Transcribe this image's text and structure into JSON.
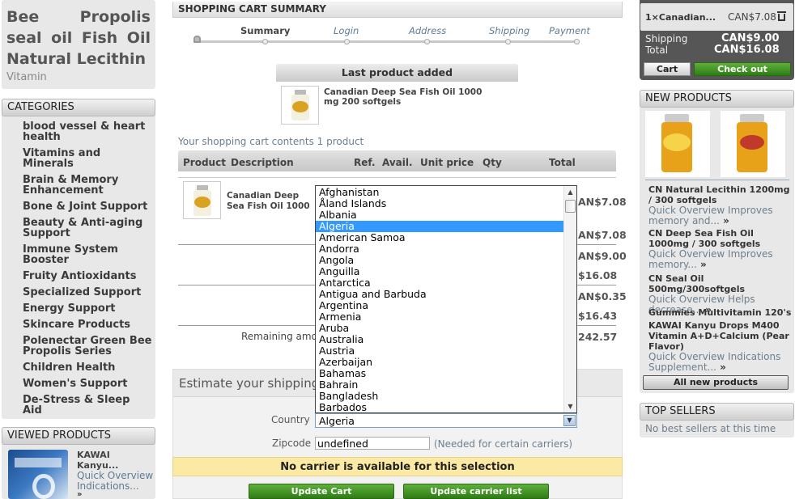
{
  "left": {
    "product_title": "Bee Propolis seal oil Fish Oil Natural Lecithin",
    "product_subtitle": "Vitamin",
    "categories_header": "CATEGORIES",
    "categories": [
      "blood vessel & heart health",
      "Vitamins and Minerals",
      "Brain & Memory Enhancement",
      "Bone & Joint Support",
      "Beauty & Anti-aging Support",
      "Immune System Booster",
      "Fruity Antioxidants",
      "Specialized Support",
      "Energy Support",
      "Skincare Products",
      "Polenectar Green Bee Propolis Series",
      "Children Health",
      "Women's Support",
      "De-Stress & Sleep Aid"
    ],
    "viewed_header": "VIEWED PRODUCTS",
    "viewed_name": "KAWAI Kanyu...",
    "viewed_desc": "Quick Overview Indications..."
  },
  "center": {
    "header": "SHOPPING CART SUMMARY",
    "steps": [
      "Summary",
      "Login",
      "Address",
      "Shipping",
      "Payment"
    ],
    "last_added_label": "Last product added",
    "last_added_name": "Canadian Deep Sea Fish Oil 1000 mg 200 softgels",
    "contents_text": "Your shopping cart contents 1 product",
    "columns": [
      "Product",
      "Description",
      "Ref.",
      "Avail.",
      "Unit price",
      "Qty",
      "Total"
    ],
    "row_name": "Canadian Deep Sea Fish Oil 1000 mg 200 softgels",
    "row_total": "AN$7.08",
    "summary_values": [
      "AN$7.08",
      "AN$9.00",
      "$16.08",
      "AN$0.35",
      "$16.43"
    ],
    "remaining_label": "Remaining amou",
    "remaining_value": "242.57",
    "estimate_title": "Estimate your shipping",
    "country_label": "Country",
    "country_value": "Algeria",
    "zip_label": "Zipcode",
    "zip_value": "undefined",
    "zip_note": "(Needed for certain carriers)",
    "no_carrier": "No carrier is available for this selection",
    "update_cart": "Update Cart",
    "update_carrier": "Update carrier list"
  },
  "dropdown": {
    "options": [
      "Afghanistan",
      "Åland Islands",
      "Albania",
      "Algeria",
      "American Samoa",
      "Andorra",
      "Angola",
      "Anguilla",
      "Antarctica",
      "Antigua and Barbuda",
      "Argentina",
      "Armenia",
      "Aruba",
      "Australia",
      "Austria",
      "Azerbaijan",
      "Bahamas",
      "Bahrain",
      "Bangladesh",
      "Barbados"
    ],
    "selected": "Algeria"
  },
  "right": {
    "cart_item": "1×Canadian...",
    "cart_item_price": "CAN$7.08",
    "shipping_label": "Shipping",
    "shipping_value": "CAN$9.00",
    "total_label": "Total",
    "total_value": "CAN$16.08",
    "cart_button": "Cart",
    "checkout_button": "Check out",
    "new_products_header": "NEW PRODUCTS",
    "new_products": [
      {
        "name": "CN Natural Lecithin 1200mg / 300 softgels",
        "desc": "Quick Overview Improves memory and..."
      },
      {
        "name": "CN Deep Sea Fish Oil 1000mg / 300 softgels",
        "desc": "Quick Overview Improves memory..."
      },
      {
        "name": "CN Seal Oil 500mg/300softgels",
        "desc": "Quick Overview Helps decrease..."
      },
      {
        "name": "Gummies Multivitamin 120's",
        "desc": ""
      },
      {
        "name": "KAWAI Kanyu Drops M400 Vitamin A+D+Calcium (Pear Flavor)",
        "desc": "Quick Overview Indications Supplement..."
      }
    ],
    "all_new_button": "All new products",
    "top_sellers_header": "TOP SELLERS",
    "top_sellers_text": "No best sellers at this time"
  },
  "colors": {
    "accent_green": "#3d8f1f",
    "selected_blue": "#3399ff",
    "notice_yellow": "#fbe9a4"
  }
}
